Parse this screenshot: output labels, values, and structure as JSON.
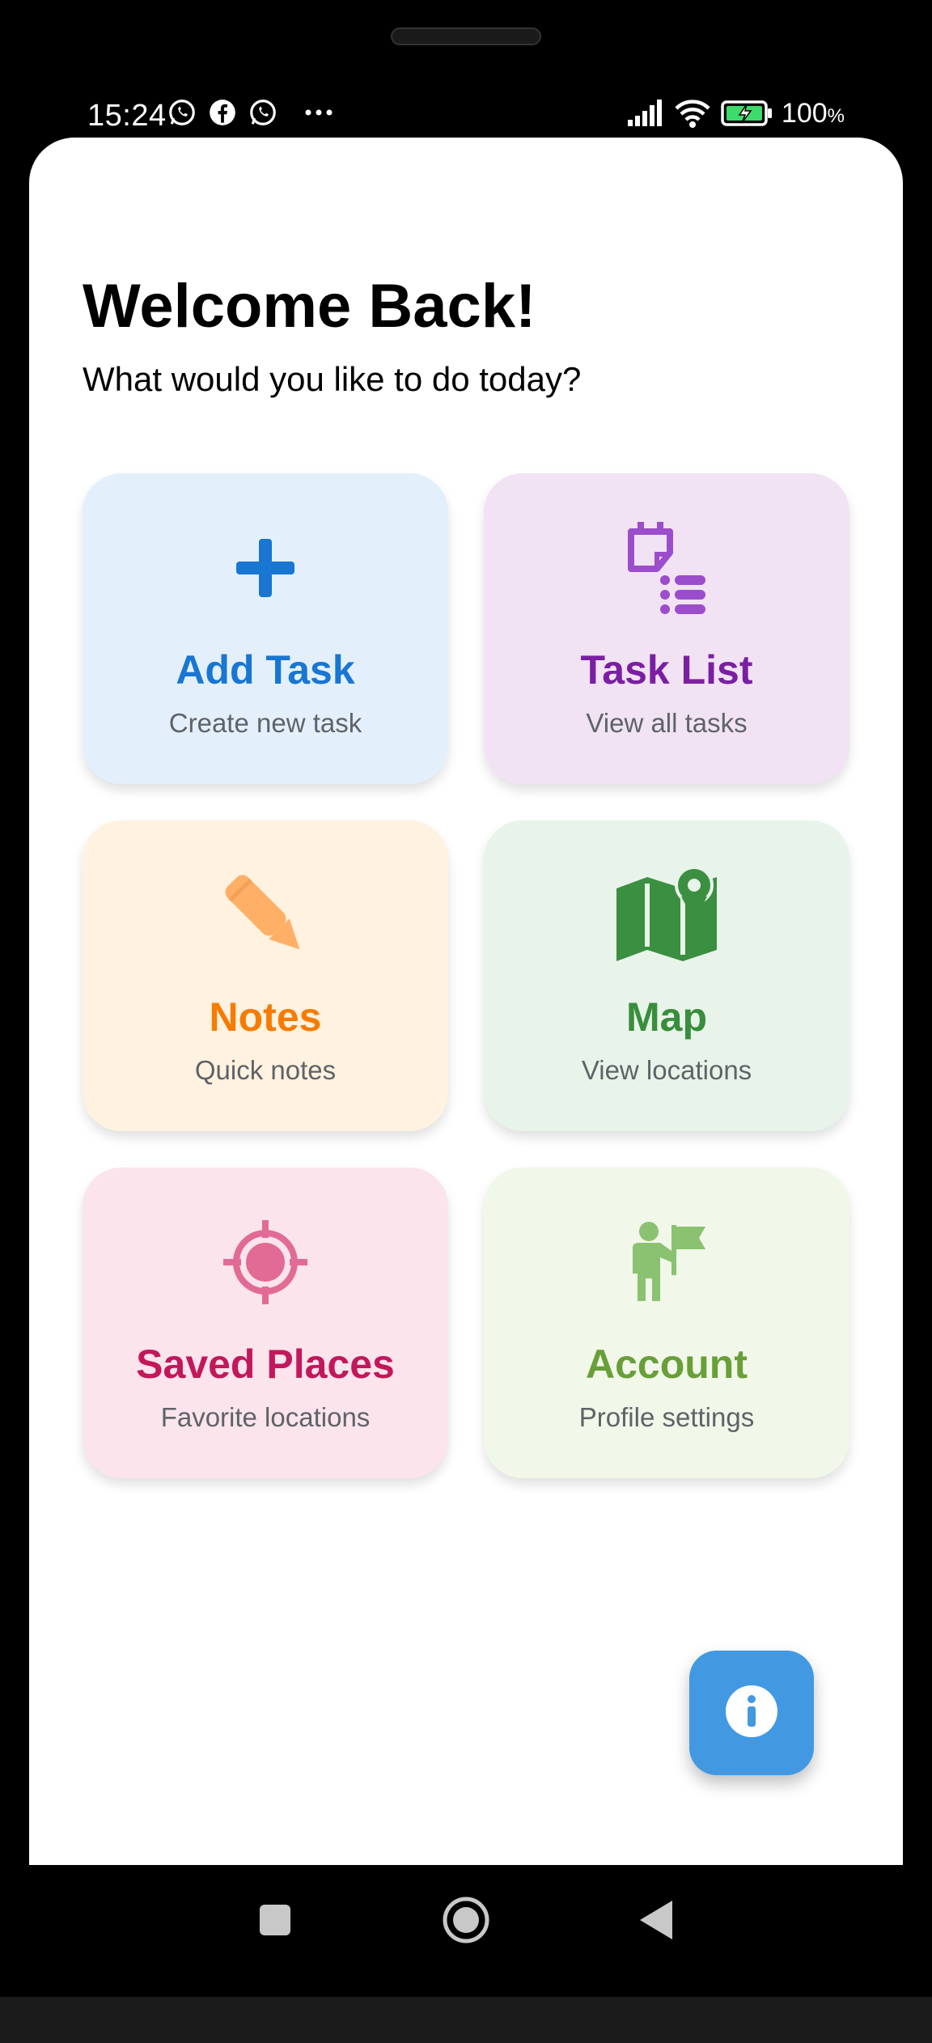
{
  "status_bar": {
    "time": "15:24",
    "battery_percent": "100",
    "battery_unit": "%",
    "notification_icons": [
      "whatsapp-icon",
      "facebook-icon",
      "whatsapp-icon",
      "more-dots-icon"
    ],
    "system_icons": [
      "signal-icon",
      "wifi-icon",
      "battery-charging-icon"
    ]
  },
  "header": {
    "title": "Welcome Back!",
    "subtitle": "What would you like to do today?"
  },
  "cards": [
    {
      "title": "Add Task",
      "subtitle": "Create new task",
      "icon": "plus-icon",
      "color": "#1976d2",
      "bg": "#e3f0fc"
    },
    {
      "title": "Task List",
      "subtitle": "View all tasks",
      "icon": "task-list-icon",
      "color": "#7b1fa2",
      "bg": "#f1e3f4"
    },
    {
      "title": "Notes",
      "subtitle": "Quick notes",
      "icon": "pencil-icon",
      "color": "#f57c00",
      "bg": "#fff2e0"
    },
    {
      "title": "Map",
      "subtitle": "View locations",
      "icon": "map-icon",
      "color": "#388e3c",
      "bg": "#e8f4e9"
    },
    {
      "title": "Saved Places",
      "subtitle": "Favorite locations",
      "icon": "target-icon",
      "color": "#c2185b",
      "bg": "#fbe4ec"
    },
    {
      "title": "Account",
      "subtitle": "Profile settings",
      "icon": "person-flag-icon",
      "color": "#689f38",
      "bg": "#f1f7e9"
    }
  ],
  "fab": {
    "icon": "info-icon",
    "color": "#4299e1"
  },
  "navigation": {
    "buttons": [
      "recent-apps-icon",
      "home-icon",
      "back-icon"
    ]
  }
}
